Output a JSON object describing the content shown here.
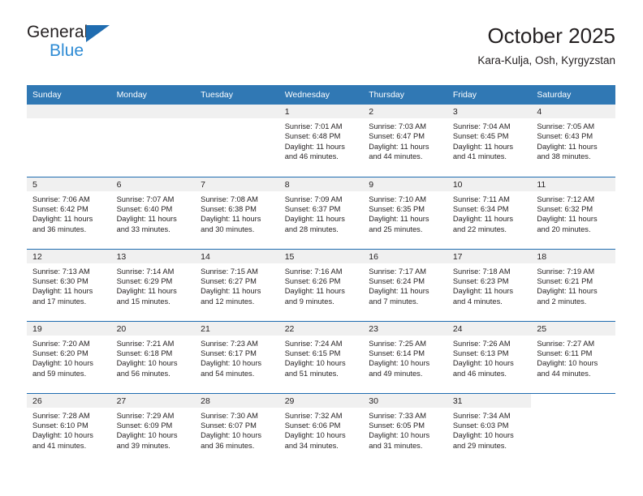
{
  "brand": {
    "name_top": "General",
    "name_bottom": "Blue",
    "triangle_icon": "brand-triangle-icon",
    "accent_color": "#1f6cb0",
    "secondary_color": "#2e8bd4"
  },
  "header": {
    "title": "October 2025",
    "subtitle": "Kara-Kulja, Osh, Kyrgyzstan"
  },
  "theme": {
    "header_blue": "#3078b4",
    "separator_blue": "#1f6cb0",
    "daynum_band": "#f0f0f0",
    "text": "#231f20"
  },
  "weekday_headers": [
    "Sunday",
    "Monday",
    "Tuesday",
    "Wednesday",
    "Thursday",
    "Friday",
    "Saturday"
  ],
  "labels": {
    "sunrise_prefix": "Sunrise:",
    "sunset_prefix": "Sunset:",
    "daylight_prefix": "Daylight:"
  },
  "weeks": [
    [
      {
        "day": "",
        "blank": true,
        "sunrise": "",
        "sunset": "",
        "daylight_line1": "",
        "daylight_line2": ""
      },
      {
        "day": "",
        "blank": true,
        "sunrise": "",
        "sunset": "",
        "daylight_line1": "",
        "daylight_line2": ""
      },
      {
        "day": "",
        "blank": true,
        "sunrise": "",
        "sunset": "",
        "daylight_line1": "",
        "daylight_line2": ""
      },
      {
        "day": "1",
        "sunrise": "Sunrise: 7:01 AM",
        "sunset": "Sunset: 6:48 PM",
        "daylight_line1": "Daylight: 11 hours",
        "daylight_line2": "and 46 minutes."
      },
      {
        "day": "2",
        "sunrise": "Sunrise: 7:03 AM",
        "sunset": "Sunset: 6:47 PM",
        "daylight_line1": "Daylight: 11 hours",
        "daylight_line2": "and 44 minutes."
      },
      {
        "day": "3",
        "sunrise": "Sunrise: 7:04 AM",
        "sunset": "Sunset: 6:45 PM",
        "daylight_line1": "Daylight: 11 hours",
        "daylight_line2": "and 41 minutes."
      },
      {
        "day": "4",
        "sunrise": "Sunrise: 7:05 AM",
        "sunset": "Sunset: 6:43 PM",
        "daylight_line1": "Daylight: 11 hours",
        "daylight_line2": "and 38 minutes."
      }
    ],
    [
      {
        "day": "5",
        "sunrise": "Sunrise: 7:06 AM",
        "sunset": "Sunset: 6:42 PM",
        "daylight_line1": "Daylight: 11 hours",
        "daylight_line2": "and 36 minutes."
      },
      {
        "day": "6",
        "sunrise": "Sunrise: 7:07 AM",
        "sunset": "Sunset: 6:40 PM",
        "daylight_line1": "Daylight: 11 hours",
        "daylight_line2": "and 33 minutes."
      },
      {
        "day": "7",
        "sunrise": "Sunrise: 7:08 AM",
        "sunset": "Sunset: 6:38 PM",
        "daylight_line1": "Daylight: 11 hours",
        "daylight_line2": "and 30 minutes."
      },
      {
        "day": "8",
        "sunrise": "Sunrise: 7:09 AM",
        "sunset": "Sunset: 6:37 PM",
        "daylight_line1": "Daylight: 11 hours",
        "daylight_line2": "and 28 minutes."
      },
      {
        "day": "9",
        "sunrise": "Sunrise: 7:10 AM",
        "sunset": "Sunset: 6:35 PM",
        "daylight_line1": "Daylight: 11 hours",
        "daylight_line2": "and 25 minutes."
      },
      {
        "day": "10",
        "sunrise": "Sunrise: 7:11 AM",
        "sunset": "Sunset: 6:34 PM",
        "daylight_line1": "Daylight: 11 hours",
        "daylight_line2": "and 22 minutes."
      },
      {
        "day": "11",
        "sunrise": "Sunrise: 7:12 AM",
        "sunset": "Sunset: 6:32 PM",
        "daylight_line1": "Daylight: 11 hours",
        "daylight_line2": "and 20 minutes."
      }
    ],
    [
      {
        "day": "12",
        "sunrise": "Sunrise: 7:13 AM",
        "sunset": "Sunset: 6:30 PM",
        "daylight_line1": "Daylight: 11 hours",
        "daylight_line2": "and 17 minutes."
      },
      {
        "day": "13",
        "sunrise": "Sunrise: 7:14 AM",
        "sunset": "Sunset: 6:29 PM",
        "daylight_line1": "Daylight: 11 hours",
        "daylight_line2": "and 15 minutes."
      },
      {
        "day": "14",
        "sunrise": "Sunrise: 7:15 AM",
        "sunset": "Sunset: 6:27 PM",
        "daylight_line1": "Daylight: 11 hours",
        "daylight_line2": "and 12 minutes."
      },
      {
        "day": "15",
        "sunrise": "Sunrise: 7:16 AM",
        "sunset": "Sunset: 6:26 PM",
        "daylight_line1": "Daylight: 11 hours",
        "daylight_line2": "and 9 minutes."
      },
      {
        "day": "16",
        "sunrise": "Sunrise: 7:17 AM",
        "sunset": "Sunset: 6:24 PM",
        "daylight_line1": "Daylight: 11 hours",
        "daylight_line2": "and 7 minutes."
      },
      {
        "day": "17",
        "sunrise": "Sunrise: 7:18 AM",
        "sunset": "Sunset: 6:23 PM",
        "daylight_line1": "Daylight: 11 hours",
        "daylight_line2": "and 4 minutes."
      },
      {
        "day": "18",
        "sunrise": "Sunrise: 7:19 AM",
        "sunset": "Sunset: 6:21 PM",
        "daylight_line1": "Daylight: 11 hours",
        "daylight_line2": "and 2 minutes."
      }
    ],
    [
      {
        "day": "19",
        "sunrise": "Sunrise: 7:20 AM",
        "sunset": "Sunset: 6:20 PM",
        "daylight_line1": "Daylight: 10 hours",
        "daylight_line2": "and 59 minutes."
      },
      {
        "day": "20",
        "sunrise": "Sunrise: 7:21 AM",
        "sunset": "Sunset: 6:18 PM",
        "daylight_line1": "Daylight: 10 hours",
        "daylight_line2": "and 56 minutes."
      },
      {
        "day": "21",
        "sunrise": "Sunrise: 7:23 AM",
        "sunset": "Sunset: 6:17 PM",
        "daylight_line1": "Daylight: 10 hours",
        "daylight_line2": "and 54 minutes."
      },
      {
        "day": "22",
        "sunrise": "Sunrise: 7:24 AM",
        "sunset": "Sunset: 6:15 PM",
        "daylight_line1": "Daylight: 10 hours",
        "daylight_line2": "and 51 minutes."
      },
      {
        "day": "23",
        "sunrise": "Sunrise: 7:25 AM",
        "sunset": "Sunset: 6:14 PM",
        "daylight_line1": "Daylight: 10 hours",
        "daylight_line2": "and 49 minutes."
      },
      {
        "day": "24",
        "sunrise": "Sunrise: 7:26 AM",
        "sunset": "Sunset: 6:13 PM",
        "daylight_line1": "Daylight: 10 hours",
        "daylight_line2": "and 46 minutes."
      },
      {
        "day": "25",
        "sunrise": "Sunrise: 7:27 AM",
        "sunset": "Sunset: 6:11 PM",
        "daylight_line1": "Daylight: 10 hours",
        "daylight_line2": "and 44 minutes."
      }
    ],
    [
      {
        "day": "26",
        "sunrise": "Sunrise: 7:28 AM",
        "sunset": "Sunset: 6:10 PM",
        "daylight_line1": "Daylight: 10 hours",
        "daylight_line2": "and 41 minutes."
      },
      {
        "day": "27",
        "sunrise": "Sunrise: 7:29 AM",
        "sunset": "Sunset: 6:09 PM",
        "daylight_line1": "Daylight: 10 hours",
        "daylight_line2": "and 39 minutes."
      },
      {
        "day": "28",
        "sunrise": "Sunrise: 7:30 AM",
        "sunset": "Sunset: 6:07 PM",
        "daylight_line1": "Daylight: 10 hours",
        "daylight_line2": "and 36 minutes."
      },
      {
        "day": "29",
        "sunrise": "Sunrise: 7:32 AM",
        "sunset": "Sunset: 6:06 PM",
        "daylight_line1": "Daylight: 10 hours",
        "daylight_line2": "and 34 minutes."
      },
      {
        "day": "30",
        "sunrise": "Sunrise: 7:33 AM",
        "sunset": "Sunset: 6:05 PM",
        "daylight_line1": "Daylight: 10 hours",
        "daylight_line2": "and 31 minutes."
      },
      {
        "day": "31",
        "sunrise": "Sunrise: 7:34 AM",
        "sunset": "Sunset: 6:03 PM",
        "daylight_line1": "Daylight: 10 hours",
        "daylight_line2": "and 29 minutes."
      },
      {
        "day": "",
        "blank": true,
        "sunrise": "",
        "sunset": "",
        "daylight_line1": "",
        "daylight_line2": ""
      }
    ]
  ]
}
